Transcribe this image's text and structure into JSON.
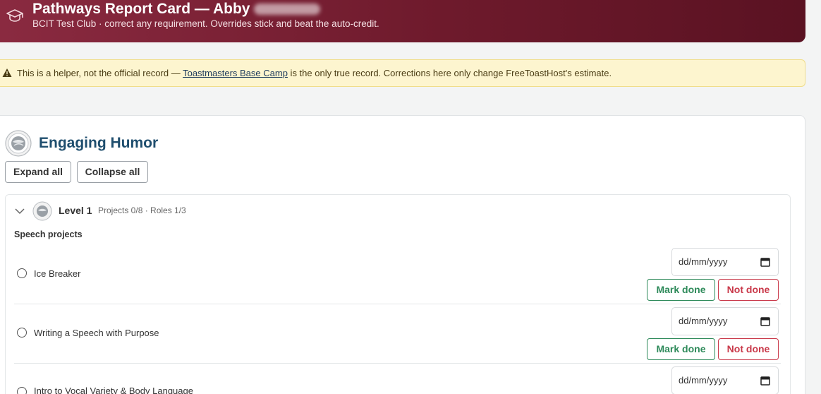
{
  "header": {
    "title": "Pathways Report Card — Abby",
    "subtitle": "BCIT Test Club · correct any requirement. Overrides stick and beat the auto-credit."
  },
  "warning": {
    "prefix": "This is a helper, not the official record — ",
    "link": "Toastmasters Base Camp",
    "suffix": " is the only true record. Corrections here only change FreeToastHost's estimate."
  },
  "path": {
    "title": "Engaging Humor",
    "expand_label": "Expand all",
    "collapse_label": "Collapse all"
  },
  "level": {
    "title": "Level 1",
    "meta": "Projects 0/8 · Roles 1/3",
    "section_label": "Speech projects",
    "projects": [
      {
        "name": "Ice Breaker",
        "date_placeholder": "dd/mm/yyyy",
        "done_label": "Mark done",
        "not_done_label": "Not done"
      },
      {
        "name": "Writing a Speech with Purpose",
        "date_placeholder": "dd/mm/yyyy",
        "done_label": "Mark done",
        "not_done_label": "Not done"
      },
      {
        "name": "Intro to Vocal Variety & Body Language",
        "date_placeholder": "dd/mm/yyyy"
      }
    ]
  },
  "colors": {
    "header_start": "#8a2a40",
    "header_end": "#5a1222",
    "title_blue": "#1f4e6e",
    "done_green": "#2e8a5a",
    "not_done_red": "#c9394a",
    "warning_bg": "#fdf5cf"
  },
  "icons": {
    "header": "graduation-cap-icon",
    "warning": "warning-triangle-icon",
    "path_badge": "pathways-badge-icon",
    "level_toggle": "chevron-down-icon",
    "date": "calendar-icon"
  }
}
